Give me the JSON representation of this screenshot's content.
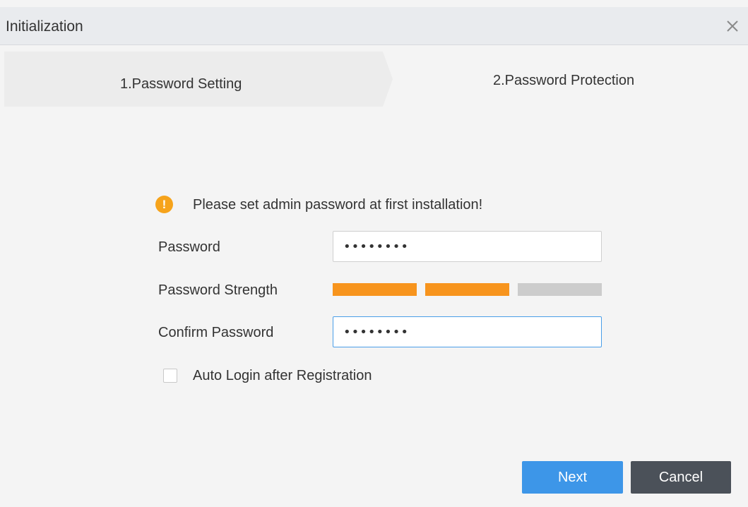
{
  "dialog": {
    "title": "Initialization",
    "close_icon": "close-icon"
  },
  "steps": [
    {
      "label": "1.Password Setting",
      "active": true
    },
    {
      "label": "2.Password Protection",
      "active": false
    }
  ],
  "warning": {
    "icon": "warning-icon",
    "text": "Please set admin password at first installation!"
  },
  "form": {
    "password_label": "Password",
    "password_value": "••••••••",
    "strength_label": "Password Strength",
    "strength_level": "2/3",
    "strength_colors": {
      "filled": "#f7941d",
      "empty": "#cccccc"
    },
    "confirm_label": "Confirm Password",
    "confirm_value": "••••••••",
    "auto_login_label": "Auto Login after Registration",
    "auto_login_checked": false
  },
  "buttons": {
    "next_label": "Next",
    "cancel_label": "Cancel"
  },
  "colors": {
    "primary": "#3d96e8",
    "secondary": "#4b5159",
    "warning": "#f6a31b"
  }
}
